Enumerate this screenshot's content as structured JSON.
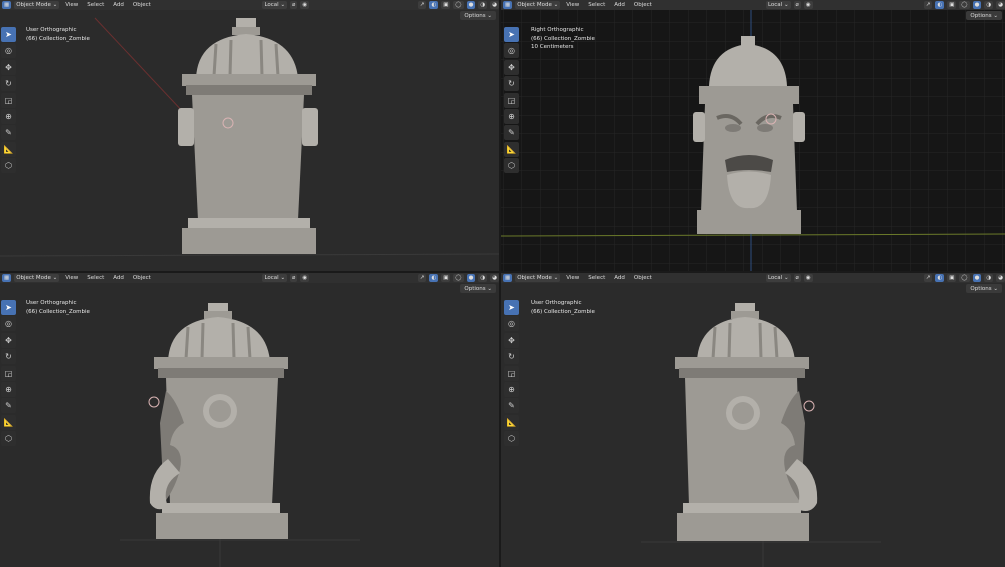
{
  "header": {
    "mode": "Object Mode",
    "menus": [
      "View",
      "Select",
      "Add",
      "Object"
    ],
    "pivot": "Local",
    "options": "Options"
  },
  "viewports": [
    {
      "view": "User Orthographic",
      "collection": "(66) Collection_Zombie",
      "scale": ""
    },
    {
      "view": "Right Orthographic",
      "collection": "(66) Collection_Zombie",
      "scale": "10 Centimeters"
    },
    {
      "view": "User Orthographic",
      "collection": "(66) Collection_Zombie",
      "scale": ""
    },
    {
      "view": "User Orthographic",
      "collection": "(66) Collection_Zombie",
      "scale": ""
    }
  ],
  "toolbar": [
    "select-box-icon",
    "cursor-icon",
    "move-icon",
    "rotate-icon",
    "scale-icon",
    "transform-icon",
    "annotate-icon",
    "measure-icon",
    "add-cube-icon"
  ],
  "colors": {
    "accent": "#4772b3",
    "bg": "#2b2b2b",
    "header": "#303030",
    "model": "#9d9a94"
  }
}
